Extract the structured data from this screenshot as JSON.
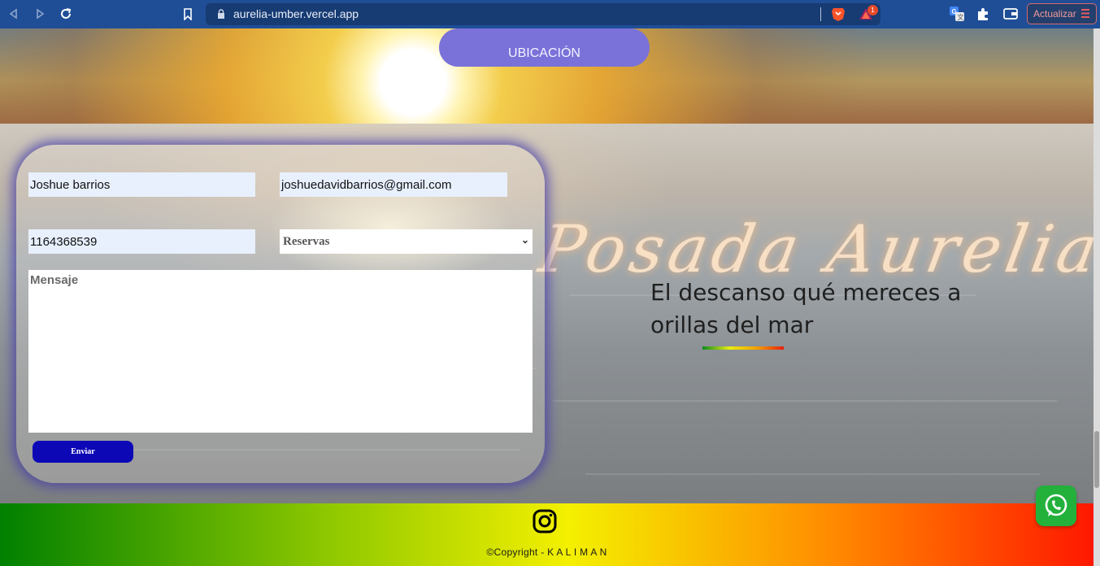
{
  "browser": {
    "url": "aurelia-umber.vercel.app",
    "update_label": "Actualizar",
    "brave_badge_count": "1"
  },
  "header": {
    "location_button": "UBICACIÓN"
  },
  "form": {
    "name_value": "Joshue barrios",
    "email_value": "joshuedavidbarrios@gmail.com",
    "phone_value": "1164368539",
    "subject_selected": "Reservas",
    "message_placeholder": "Mensaje",
    "submit_label": "Enviar"
  },
  "hero": {
    "brand_script": "Posada Aurelia",
    "tagline": "El descanso qué mereces a orillas del mar"
  },
  "footer": {
    "copyright": "©Copyright - K A L I M A N"
  },
  "icons": {
    "instagram": "instagram-icon",
    "whatsapp": "whatsapp-icon"
  },
  "colors": {
    "chrome_bg": "#1f4e97",
    "location_button": "#7a72d9",
    "submit_button": "#0c08b5",
    "whatsapp": "#23b13c",
    "footer_gradient": [
      "#008000",
      "#8ec800",
      "#f4f000",
      "#ff8b00",
      "#ff1800"
    ]
  }
}
